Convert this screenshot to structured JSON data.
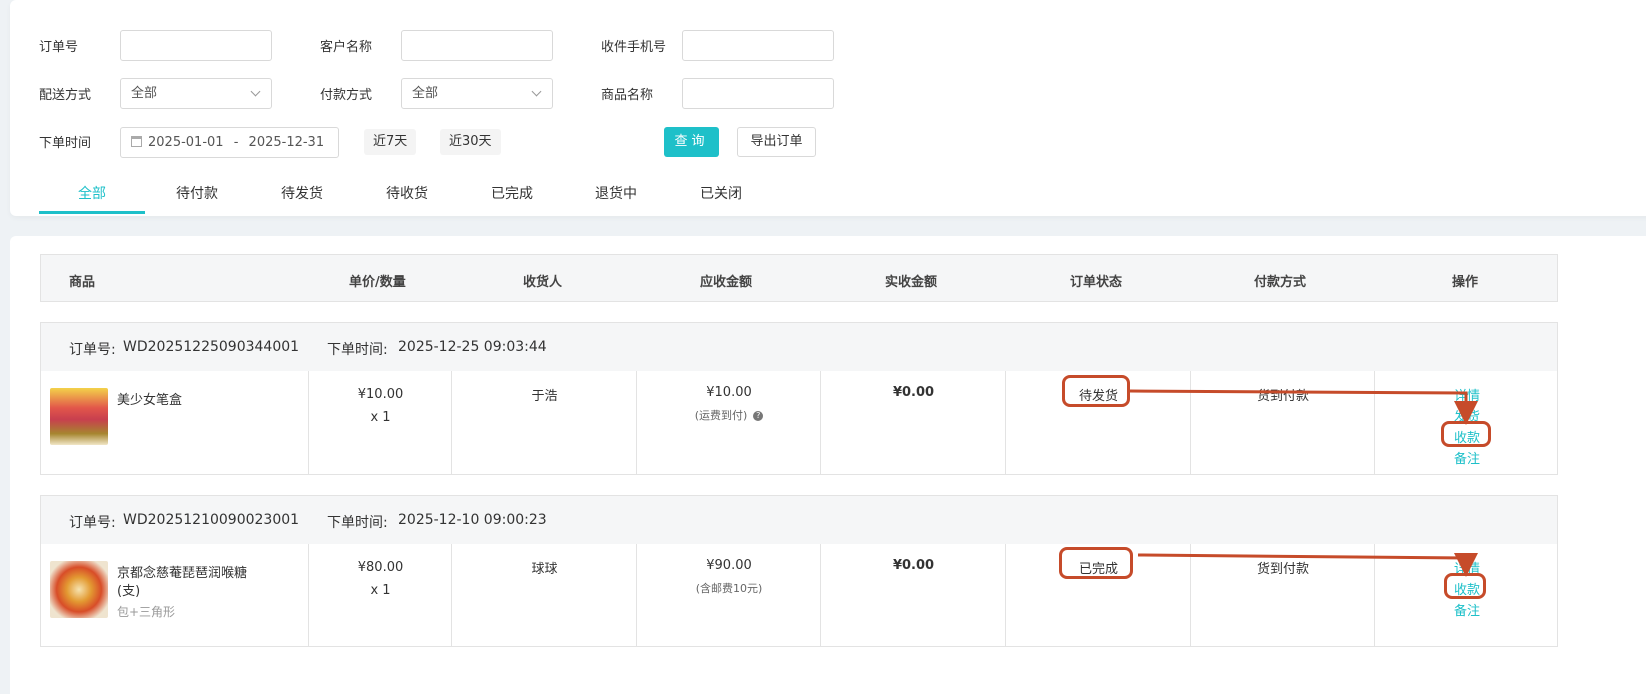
{
  "filters": {
    "order_no_label": "订单号",
    "customer_label": "客户名称",
    "phone_label": "收件手机号",
    "delivery_label": "配送方式",
    "delivery_value": "全部",
    "payment_label": "付款方式",
    "payment_value": "全部",
    "product_label": "商品名称",
    "order_time_label": "下单时间",
    "date_start": "2025-01-01",
    "date_sep": "-",
    "date_end": "2025-12-31",
    "quick_7": "近7天",
    "quick_30": "近30天",
    "query_label": "查询",
    "export_label": "导出订单"
  },
  "tabs": [
    "全部",
    "待付款",
    "待发货",
    "待收货",
    "已完成",
    "退货中",
    "已关闭"
  ],
  "columns": [
    "商品",
    "单价/数量",
    "收货人",
    "应收金额",
    "实收金额",
    "订单状态",
    "付款方式",
    "操作"
  ],
  "orders": [
    {
      "order_no_label": "订单号:",
      "order_no": "WD20251225090344001",
      "time_label": "下单时间:",
      "time": "2025-12-25 09:03:44",
      "product_name": "美少女笔盒",
      "product_name_2": "",
      "product_spec": "",
      "price": "¥10.00",
      "qty": "x 1",
      "receiver": "于浩",
      "receivable": "¥10.00",
      "receivable_note": "(运费到付)",
      "received": "¥0.00",
      "status": "待发货",
      "payment": "货到付款",
      "actions": [
        "详情",
        "发货",
        "收款",
        "备注"
      ]
    },
    {
      "order_no_label": "订单号:",
      "order_no": "WD20251210090023001",
      "time_label": "下单时间:",
      "time": "2025-12-10 09:00:23",
      "product_name": "京都念慈菴琵琶润喉糖",
      "product_name_2": "(支)",
      "product_spec": "包+三角形",
      "price": "¥80.00",
      "qty": "x 1",
      "receiver": "球球",
      "receivable": "¥90.00",
      "receivable_note": "(含邮费10元)",
      "received": "¥0.00",
      "status": "已完成",
      "payment": "货到付款",
      "actions": [
        "详情",
        "收款",
        "备注"
      ]
    }
  ],
  "colors": {
    "accent": "#1ec0c9",
    "highlight": "#c64b2a"
  }
}
